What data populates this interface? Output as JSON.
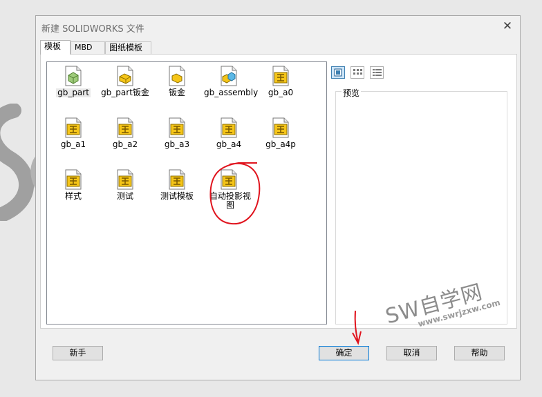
{
  "dialog": {
    "title": "新建 SOLIDWORKS 文件",
    "close_glyph": "✕"
  },
  "tabs": [
    {
      "label": "模板",
      "active": true
    },
    {
      "label": "MBD",
      "active": false
    },
    {
      "label": "图纸模板",
      "active": false
    }
  ],
  "templates": [
    {
      "label": "gb_part",
      "icon": "part-icon",
      "selected": true
    },
    {
      "label": "gb_part钣金",
      "icon": "sheetmetal-part-icon"
    },
    {
      "label": "钣金",
      "icon": "sheetmetal-icon"
    },
    {
      "label": "gb_assembly",
      "icon": "assembly-icon"
    },
    {
      "label": "gb_a0",
      "icon": "drawing-icon"
    },
    {
      "label": "gb_a1",
      "icon": "drawing-icon"
    },
    {
      "label": "gb_a2",
      "icon": "drawing-icon"
    },
    {
      "label": "gb_a3",
      "icon": "drawing-icon"
    },
    {
      "label": "gb_a4",
      "icon": "drawing-icon"
    },
    {
      "label": "gb_a4p",
      "icon": "drawing-icon"
    },
    {
      "label": "样式",
      "icon": "drawing-icon"
    },
    {
      "label": "测试",
      "icon": "drawing-icon"
    },
    {
      "label": "测试模板",
      "icon": "drawing-icon"
    },
    {
      "label": "自动投影视图",
      "icon": "drawing-icon"
    }
  ],
  "view_modes": [
    "large-icons-view-icon",
    "list-view-icon",
    "details-view-icon"
  ],
  "preview": {
    "label": "预览"
  },
  "buttons": {
    "novice": "新手",
    "ok": "确定",
    "cancel": "取消",
    "help": "帮助"
  },
  "watermark": {
    "main": "SW自学网",
    "sub": "www.swrjzxw.com"
  },
  "colors": {
    "accent": "#0078d7",
    "annotation_red": "#e0141e",
    "icon_yellow": "#f5c518"
  }
}
